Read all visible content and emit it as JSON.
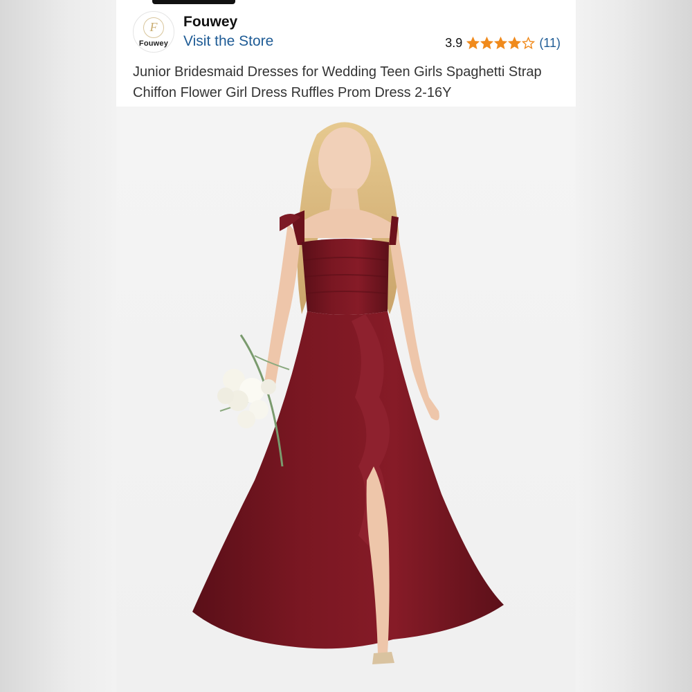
{
  "store": {
    "logo_text": "Fouwey",
    "logo_monogram": "F",
    "name": "Fouwey",
    "visit_link": "Visit the Store"
  },
  "rating": {
    "score": "3.9",
    "stars_value": 3.9,
    "stars_max": 5,
    "review_count": "(11)",
    "star_color": "#f08a1c"
  },
  "product": {
    "title": "Junior Bridesmaid Dresses for Wedding Teen Girls Spaghetti Strap Chiffon Flower Girl Dress Ruffles Prom Dress 2-16Y",
    "image": {
      "description_icon": "product-photo",
      "dress_color": "#7a1722"
    }
  },
  "colors": {
    "link": "#1e5b95",
    "text": "#333333"
  }
}
